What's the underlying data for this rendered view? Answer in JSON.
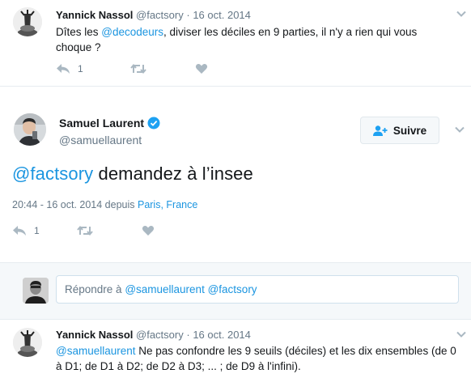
{
  "colors": {
    "link": "#1b95e0",
    "muted": "#657786",
    "icon": "#aab8c2",
    "verified": "#1da1f2",
    "panel_bg": "#f5f8fa"
  },
  "tweet1": {
    "name": "Yannick Nassol",
    "handle": "@factsory",
    "sep": "·",
    "date": "16 oct. 2014",
    "text_before": "Dîtes les ",
    "mention": "@decodeurs",
    "text_after": ", diviser les déciles en 9 parties, il n'y a rien qui vous choque ?",
    "reply_count": "1",
    "icons": [
      "reply-icon",
      "retweet-icon",
      "like-icon",
      "chevron-down-icon"
    ]
  },
  "main_tweet": {
    "name": "Samuel Laurent",
    "handle": "@samuellaurent",
    "follow_label": "Suivre",
    "mention": "@factsory",
    "text": " demandez à l’insee",
    "timestamp": "20:44 - 16 oct. 2014 depuis ",
    "location_city": "Paris",
    "location_sep": ", ",
    "location_country": "France",
    "reply_count": "1",
    "icons": [
      "verified-icon",
      "follow-icon",
      "reply-icon",
      "retweet-icon",
      "like-icon",
      "chevron-down-icon"
    ]
  },
  "reply_box": {
    "prefix": "Répondre à ",
    "mention1": "@samuellaurent",
    "space": " ",
    "mention2": "@factsory"
  },
  "tweet3": {
    "name": "Yannick Nassol",
    "handle": "@factsory",
    "sep": "·",
    "date": "16 oct. 2014",
    "mention": "@samuellaurent",
    "text": " Ne pas confondre les 9 seuils (déciles) et les dix ensembles (de 0 à D1; de D1 à D2; de D2 à D3; ... ; de D9 à l'infini)."
  }
}
